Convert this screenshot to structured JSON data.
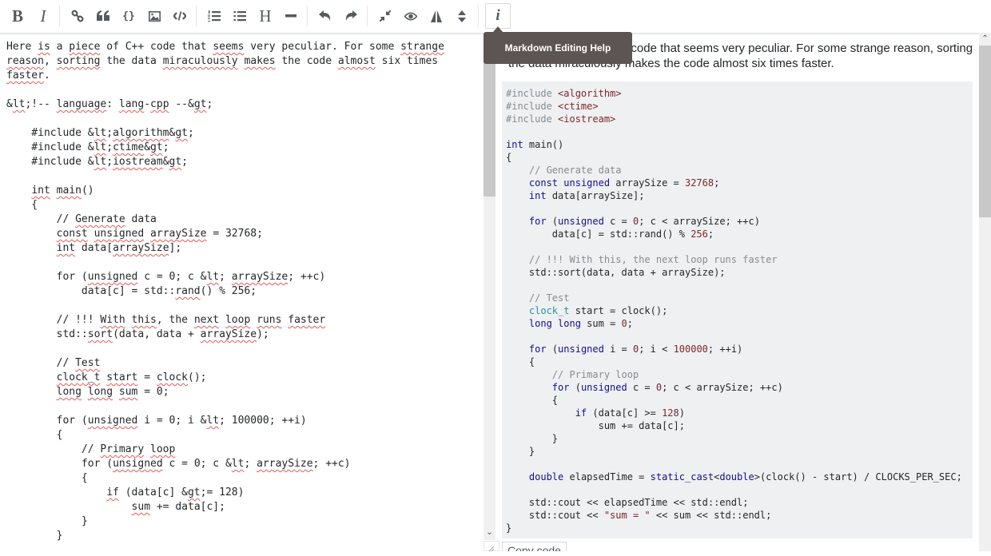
{
  "toolbar": {
    "buttons": [
      {
        "name": "bold",
        "label": "B"
      },
      {
        "name": "italic",
        "label": "I"
      },
      {
        "name": "link"
      },
      {
        "name": "blockquote"
      },
      {
        "name": "code-sample"
      },
      {
        "name": "image"
      },
      {
        "name": "snippet"
      },
      {
        "name": "numbered-list"
      },
      {
        "name": "bulleted-list"
      },
      {
        "name": "heading",
        "label": "H"
      },
      {
        "name": "horizontal-rule"
      },
      {
        "name": "undo"
      },
      {
        "name": "redo"
      },
      {
        "name": "collapse"
      },
      {
        "name": "preview-toggle"
      },
      {
        "name": "side-by-side"
      },
      {
        "name": "resize"
      },
      {
        "name": "help",
        "label": "i"
      }
    ],
    "tooltip": "Markdown Editing Help"
  },
  "editor": {
    "intro_line1": "Here is a piece of C++ code that seems very peculiar. For some strange",
    "intro_line2": "reason, sorting the data miraculously makes the code almost six times",
    "intro_line3": "faster.",
    "language_hint": "<!-- language: lang-cpp -->",
    "code_lines": [
      "    #include <algorithm>",
      "    #include <ctime>",
      "    #include <iostream>",
      "",
      "    int main()",
      "    {",
      "        // Generate data",
      "        const unsigned arraySize = 32768;",
      "        int data[arraySize];",
      "",
      "        for (unsigned c = 0; c < arraySize; ++c)",
      "            data[c] = std::rand() % 256;",
      "",
      "        // !!! With this, the next loop runs faster",
      "        std::sort(data, data + arraySize);",
      "",
      "        // Test",
      "        clock_t start = clock();",
      "        long long sum = 0;",
      "",
      "        for (unsigned i = 0; i < 100000; ++i)",
      "        {",
      "            // Primary loop",
      "            for (unsigned c = 0; c < arraySize; ++c)",
      "            {",
      "                if (data[c] >= 128)",
      "                    sum += data[c];",
      "            }",
      "        }"
    ]
  },
  "preview": {
    "paragraph": "Here is a piece of C++ code that seems very peculiar. For some strange reason, sorting the data miraculously makes the code almost six times faster.",
    "copy_code_label": "Copy code",
    "code_lines": [
      "#include <algorithm>",
      "#include <ctime>",
      "#include <iostream>",
      "",
      "int main()",
      "{",
      "    // Generate data",
      "    const unsigned arraySize = 32768;",
      "    int data[arraySize];",
      "",
      "    for (unsigned c = 0; c < arraySize; ++c)",
      "        data[c] = std::rand() % 256;",
      "",
      "    // !!! With this, the next loop runs faster",
      "    std::sort(data, data + arraySize);",
      "",
      "    // Test",
      "    clock_t start = clock();",
      "    long long sum = 0;",
      "",
      "    for (unsigned i = 0; i < 100000; ++i)",
      "    {",
      "        // Primary loop",
      "        for (unsigned c = 0; c < arraySize; ++c)",
      "        {",
      "            if (data[c] >= 128)",
      "                sum += data[c];",
      "        }",
      "    }",
      "",
      "    double elapsedTime = static_cast<double>(clock() - start) / CLOCKS_PER_SEC;",
      "",
      "    std::cout << elapsedTime << std::endl;",
      "    std::cout << \"sum = \" << sum << std::endl;",
      "}"
    ]
  },
  "colors": {
    "keyword": "#101094",
    "type": "#2b91af",
    "comment": "#858c93",
    "literal": "#7d2727",
    "code_bg": "#eff0f1",
    "tooltip_bg": "#5d5553",
    "spellcheck": "#e35a5a"
  }
}
